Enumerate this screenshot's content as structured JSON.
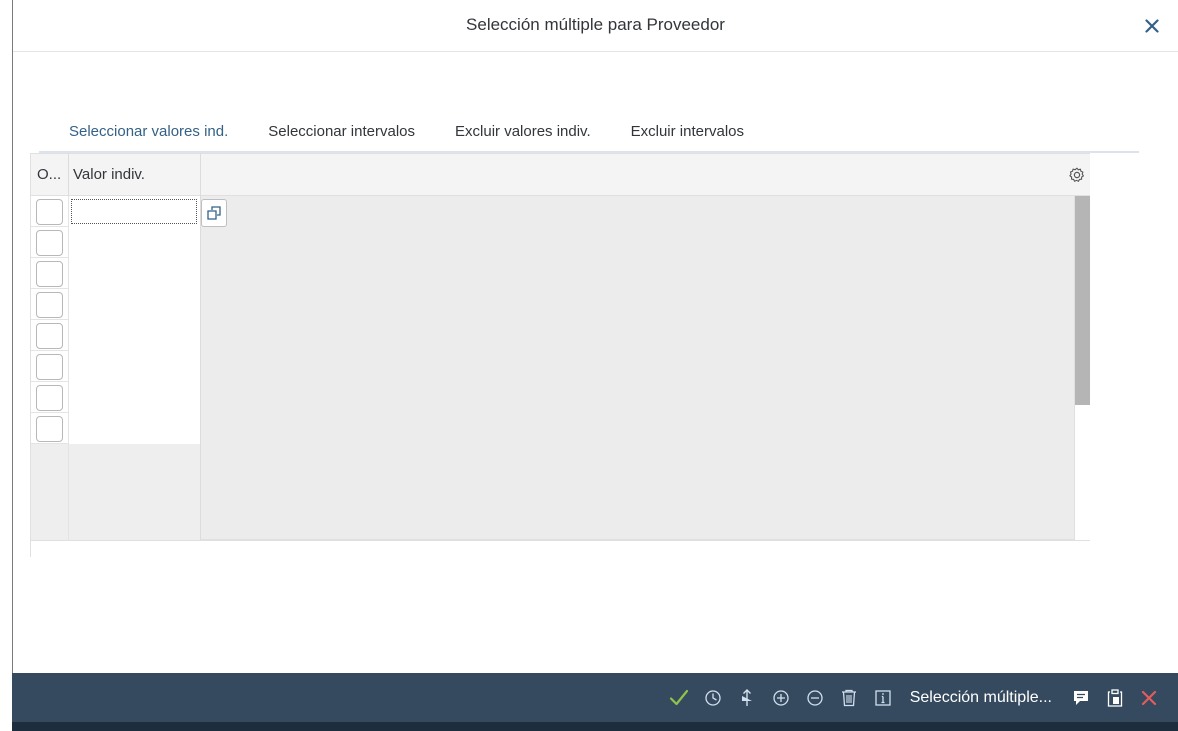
{
  "dialog": {
    "title": "Selección múltiple para Proveedor"
  },
  "tabs": [
    {
      "label": "Seleccionar valores ind.",
      "active": true
    },
    {
      "label": "Seleccionar intervalos",
      "active": false
    },
    {
      "label": "Excluir valores indiv.",
      "active": false
    },
    {
      "label": "Excluir intervalos",
      "active": false
    }
  ],
  "table": {
    "col_option": "O...",
    "col_value": "Valor indiv.",
    "first_value": ""
  },
  "footer": {
    "menu_label": "Selección múltiple..."
  },
  "colors": {
    "accent": "#427cac",
    "footer_bg": "#354a5f",
    "check": "#8fc34a",
    "cancel": "#e25d5d"
  }
}
